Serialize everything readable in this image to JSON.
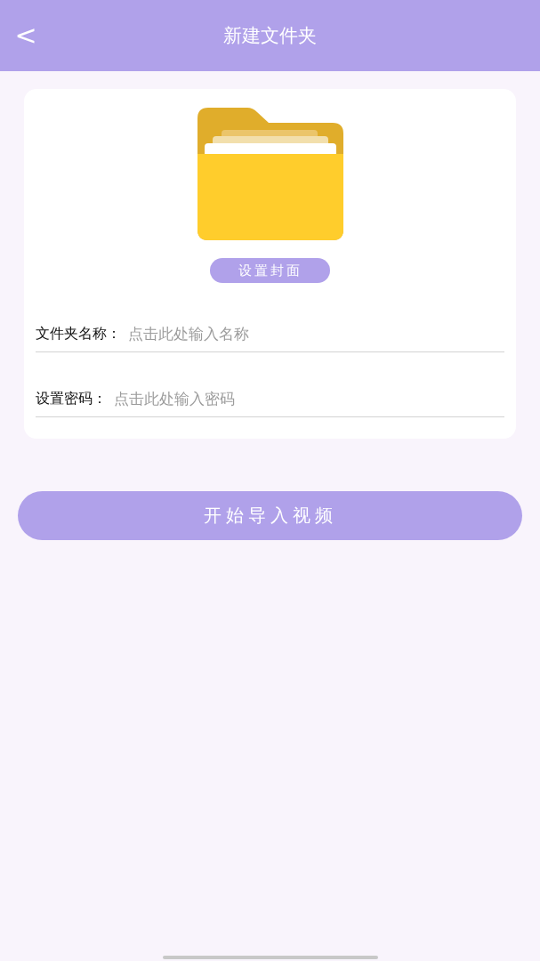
{
  "header": {
    "back": "<",
    "title": "新建文件夹"
  },
  "cover_button": "设置封面",
  "fields": [
    {
      "label": "文件夹名称：",
      "placeholder": "点击此处输入名称"
    },
    {
      "label": "设置密码：",
      "placeholder": "点击此处输入密码"
    }
  ],
  "primary_button": "开始导入视频"
}
